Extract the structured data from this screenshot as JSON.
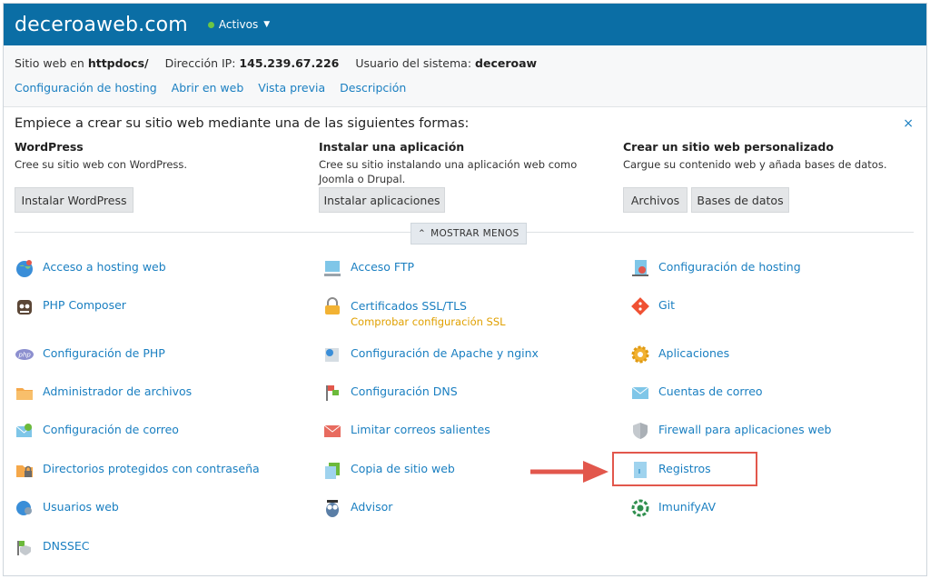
{
  "header": {
    "domain": "deceroaweb.com",
    "status_label": "Activos"
  },
  "info": {
    "site_label": "Sitio web en",
    "site_value": "httpdocs/",
    "ip_label": "Dirección IP:",
    "ip_value": "145.239.67.226",
    "user_label": "Usuario del sistema:",
    "user_value": "deceroaw"
  },
  "links": [
    "Configuración de hosting",
    "Abrir en web",
    "Vista previa",
    "Descripción"
  ],
  "intro": {
    "title": "Empiece a crear su sitio web mediante una de las siguientes formas:",
    "close": "×",
    "columns": [
      {
        "title": "WordPress",
        "desc": "Cree su sitio web con WordPress.",
        "buttons": [
          "Instalar WordPress"
        ]
      },
      {
        "title": "Instalar una aplicación",
        "desc": "Cree su sitio instalando una aplicación web como Joomla o Drupal.",
        "buttons": [
          "Instalar aplicaciones"
        ]
      },
      {
        "title": "Crear un sitio web personalizado",
        "desc": "Cargue su contenido web y añada bases de datos.",
        "buttons": [
          "Archivos",
          "Bases de datos"
        ]
      }
    ],
    "toggle_label": "MOSTRAR MENOS"
  },
  "tools": {
    "col1": [
      {
        "label": "Acceso a hosting web",
        "icon": "globe-user-icon"
      },
      {
        "label": "PHP Composer",
        "icon": "composer-icon"
      },
      {
        "label": "Configuración de PHP",
        "icon": "php-icon"
      },
      {
        "label": "Administrador de archivos",
        "icon": "folder-icon"
      },
      {
        "label": "Configuración de correo",
        "icon": "mail-settings-icon"
      },
      {
        "label": "Directorios protegidos con contraseña",
        "icon": "folder-lock-icon"
      },
      {
        "label": "Usuarios web",
        "icon": "web-users-icon"
      },
      {
        "label": "DNSSEC",
        "icon": "dnssec-icon"
      }
    ],
    "col2": [
      {
        "label": "Acceso FTP",
        "icon": "ftp-icon"
      },
      {
        "label": "Certificados SSL/TLS",
        "sub": "Comprobar configuración SSL",
        "icon": "lock-icon"
      },
      {
        "label": "Configuración de Apache y nginx",
        "icon": "server-settings-icon"
      },
      {
        "label": "Configuración DNS",
        "icon": "dns-flags-icon"
      },
      {
        "label": "Limitar correos salientes",
        "icon": "mail-limit-icon"
      },
      {
        "label": "Copia de sitio web",
        "icon": "copy-icon"
      },
      {
        "label": "Advisor",
        "icon": "owl-icon"
      }
    ],
    "col3": [
      {
        "label": "Configuración de hosting",
        "icon": "hosting-settings-icon"
      },
      {
        "label": "Git",
        "icon": "git-icon"
      },
      {
        "label": "Aplicaciones",
        "icon": "gear-icon"
      },
      {
        "label": "Cuentas de correo",
        "icon": "envelope-icon"
      },
      {
        "label": "Firewall para aplicaciones web",
        "icon": "shield-icon"
      },
      {
        "label": "Registros",
        "icon": "logs-icon"
      },
      {
        "label": "ImunifyAV",
        "icon": "imunify-icon"
      }
    ]
  },
  "colors": {
    "header": "#0b6ea5",
    "link": "#1a7fc1",
    "status_ok": "#6cc644",
    "warning_link": "#e0a000",
    "highlight": "#e2574c"
  }
}
